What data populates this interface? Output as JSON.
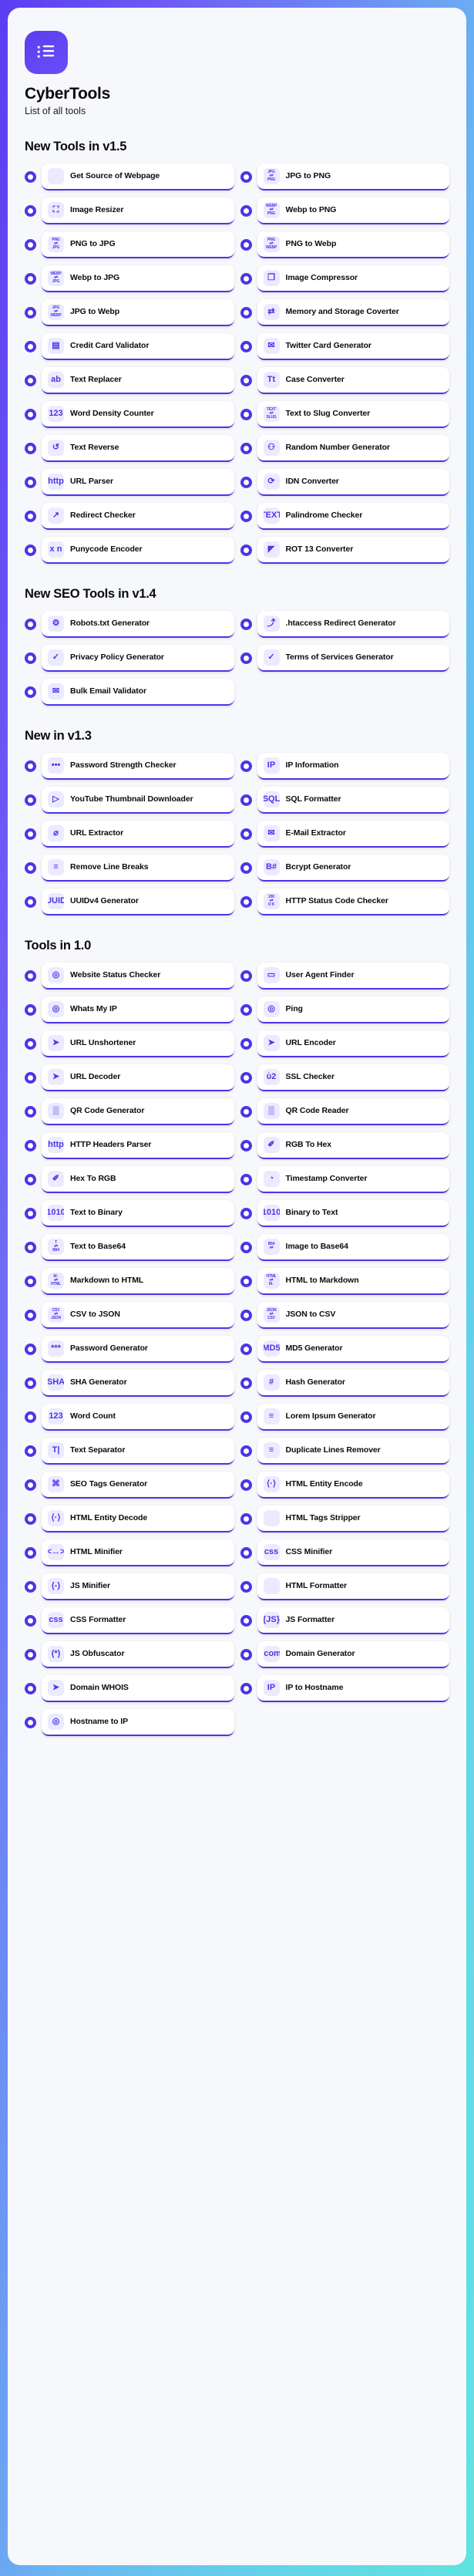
{
  "brand": {
    "logo_icon": "list-star-icon",
    "title": "CyberTools",
    "subtitle": "List of all tools"
  },
  "theme": {
    "accent": "#4c35e6",
    "icon_bg": "#eceaff",
    "page_bg": "#f7f8fb",
    "gradient_start": "#5b3df0",
    "gradient_end": "#5fe3e0"
  },
  "sections": [
    {
      "title": "New Tools in v1.5",
      "tools": [
        {
          "label": "Get Source of Webpage",
          "icon": "browser-code-icon",
          "glyph": "</>"
        },
        {
          "label": "JPG to PNG",
          "icon": "jpg-to-png-icon",
          "from": "JPG",
          "to": "PNG"
        },
        {
          "label": "Image Resizer",
          "icon": "image-resize-icon",
          "glyph": "⛶"
        },
        {
          "label": "Webp to PNG",
          "icon": "webp-to-png-icon",
          "from": "WEBP",
          "to": "PNG"
        },
        {
          "label": "PNG to JPG",
          "icon": "png-to-jpg-icon",
          "from": "PNG",
          "to": "JPG"
        },
        {
          "label": "PNG to Webp",
          "icon": "png-to-webp-icon",
          "from": "PNG",
          "to": "WEBP"
        },
        {
          "label": "Webp to JPG",
          "icon": "webp-to-jpg-icon",
          "from": "WEBP",
          "to": "JPG"
        },
        {
          "label": "Image Compressor",
          "icon": "image-compress-icon",
          "glyph": "❐"
        },
        {
          "label": "JPG to Webp",
          "icon": "jpg-to-webp-icon",
          "from": "JPG",
          "to": "WEBP"
        },
        {
          "label": "Memory and Storage Coverter",
          "icon": "memory-storage-icon",
          "glyph": "⇄"
        },
        {
          "label": "Credit Card Validator",
          "icon": "credit-card-icon",
          "glyph": "▤"
        },
        {
          "label": "Twitter Card Generator",
          "icon": "twitter-card-icon",
          "glyph": "✉"
        },
        {
          "label": "Text Replacer",
          "icon": "text-replace-icon",
          "glyph": "ab"
        },
        {
          "label": "Case Converter",
          "icon": "case-convert-icon",
          "glyph": "Tt"
        },
        {
          "label": "Word Density Counter",
          "icon": "word-density-icon",
          "glyph": "123"
        },
        {
          "label": "Text to Slug Converter",
          "icon": "text-to-slug-icon",
          "from": "TEXT",
          "to": "SLUG"
        },
        {
          "label": "Text Reverse",
          "icon": "text-reverse-icon",
          "glyph": "↺"
        },
        {
          "label": "Random Number Generator",
          "icon": "random-number-icon",
          "glyph": "⚇"
        },
        {
          "label": "URL Parser",
          "icon": "url-parser-icon",
          "glyph": "http"
        },
        {
          "label": "IDN Converter",
          "icon": "idn-converter-icon",
          "glyph": "⟳"
        },
        {
          "label": "Redirect Checker",
          "icon": "redirect-arrow-icon",
          "glyph": "↗"
        },
        {
          "label": "Palindrome Checker",
          "icon": "palindrome-icon",
          "glyph": "TEXT"
        },
        {
          "label": "Punycode Encoder",
          "icon": "punycode-icon",
          "glyph": "x n"
        },
        {
          "label": "ROT 13 Converter",
          "icon": "rot13-icon",
          "glyph": "◤"
        }
      ]
    },
    {
      "title": "New SEO Tools in v1.4",
      "tools": [
        {
          "label": "Robots.txt Generator",
          "icon": "robot-icon",
          "glyph": "⚙"
        },
        {
          "label": ".htaccess Redirect Generator",
          "icon": "htaccess-redirect-icon",
          "glyph": "⤴"
        },
        {
          "label": "Privacy Policy Generator",
          "icon": "shield-check-icon",
          "glyph": "✓"
        },
        {
          "label": "Terms of Services Generator",
          "icon": "clipboard-check-icon",
          "glyph": "✓"
        },
        {
          "label": "Bulk Email Validator",
          "icon": "email-check-icon",
          "glyph": "✉"
        }
      ]
    },
    {
      "title": "New in v1.3",
      "tools": [
        {
          "label": "Password Strength Checker",
          "icon": "password-dots-icon",
          "glyph": "•••"
        },
        {
          "label": "IP Information",
          "icon": "ip-info-icon",
          "glyph": "IP"
        },
        {
          "label": "YouTube Thumbnail Downloader",
          "icon": "youtube-play-icon",
          "glyph": "▷"
        },
        {
          "label": "SQL Formatter",
          "icon": "sql-icon",
          "glyph": "SQL"
        },
        {
          "label": "URL Extractor",
          "icon": "url-extract-icon",
          "glyph": "⌀"
        },
        {
          "label": "E-Mail Extractor",
          "icon": "email-extract-icon",
          "glyph": "✉"
        },
        {
          "label": "Remove Line Breaks",
          "icon": "line-break-remove-icon",
          "glyph": "≡"
        },
        {
          "label": "Bcrypt Generator",
          "icon": "bcrypt-icon",
          "glyph": "B#"
        },
        {
          "label": "UUIDv4 Generator",
          "icon": "uuid-icon",
          "glyph": "UUID"
        },
        {
          "label": "HTTP Status Code Checker",
          "icon": "http-status-icon",
          "from": "200",
          "to": "O K"
        }
      ]
    },
    {
      "title": "Tools in 1.0",
      "tools": [
        {
          "label": "Website Status Checker",
          "icon": "signal-icon",
          "glyph": "◎"
        },
        {
          "label": "User Agent Finder",
          "icon": "window-icon",
          "glyph": "▭"
        },
        {
          "label": "Whats My IP",
          "icon": "location-pin-icon",
          "glyph": "◎"
        },
        {
          "label": "Ping",
          "icon": "ping-search-icon",
          "glyph": "◎"
        },
        {
          "label": "URL Unshortener",
          "icon": "url-cursor-icon",
          "glyph": "➤"
        },
        {
          "label": "URL Encoder",
          "icon": "url-cursor-icon",
          "glyph": "➤"
        },
        {
          "label": "URL Decoder",
          "icon": "url-cursor-icon",
          "glyph": "➤"
        },
        {
          "label": "SSL Checker",
          "icon": "lock-icon",
          "glyph": "ὑ2"
        },
        {
          "label": "QR Code Generator",
          "icon": "qr-code-icon",
          "glyph": "▒"
        },
        {
          "label": "QR Code Reader",
          "icon": "qr-code-icon",
          "glyph": "▒"
        },
        {
          "label": "HTTP Headers Parser",
          "icon": "http-headers-icon",
          "glyph": "http"
        },
        {
          "label": "RGB To Hex",
          "icon": "eyedropper-icon",
          "glyph": "✐"
        },
        {
          "label": "Hex To RGB",
          "icon": "eyedropper-icon",
          "glyph": "✐"
        },
        {
          "label": "Timestamp Converter",
          "icon": "clock-icon",
          "glyph": "◔"
        },
        {
          "label": "Text to Binary",
          "icon": "binary-icon",
          "glyph": "1010"
        },
        {
          "label": "Binary to Text",
          "icon": "binary-icon",
          "glyph": "1010"
        },
        {
          "label": "Text to Base64",
          "icon": "text-base64-icon",
          "from": "T",
          "to": "B64"
        },
        {
          "label": "Image to Base64",
          "icon": "image-base64-icon",
          "from": "B64",
          "to": ""
        },
        {
          "label": "Markdown to HTML",
          "icon": "md-to-html-icon",
          "from": "M↓",
          "to": "HTML"
        },
        {
          "label": "HTML to Markdown",
          "icon": "html-to-md-icon",
          "from": "HTML",
          "to": "M↓"
        },
        {
          "label": "CSV to JSON",
          "icon": "csv-to-json-icon",
          "from": "CSV",
          "to": "JSON"
        },
        {
          "label": "JSON to CSV",
          "icon": "json-to-csv-icon",
          "from": "JSON",
          "to": "CSV"
        },
        {
          "label": "Password Generator",
          "icon": "password-asterisk-icon",
          "glyph": "***"
        },
        {
          "label": "MD5 Generator",
          "icon": "md5-icon",
          "glyph": "MD5"
        },
        {
          "label": "SHA Generator",
          "icon": "sha-icon",
          "glyph": "SHA"
        },
        {
          "label": "Hash Generator",
          "icon": "hash-icon",
          "glyph": "#"
        },
        {
          "label": "Word Count",
          "icon": "word-count-icon",
          "glyph": "123"
        },
        {
          "label": "Lorem Ipsum Generator",
          "icon": "paragraph-lines-icon",
          "glyph": "≡"
        },
        {
          "label": "Text Separator",
          "icon": "text-separator-icon",
          "glyph": "T|"
        },
        {
          "label": "Duplicate Lines Remover",
          "icon": "duplicate-remove-icon",
          "glyph": "≡"
        },
        {
          "label": "SEO Tags Generator",
          "icon": "tag-icon",
          "glyph": "⌘"
        },
        {
          "label": "HTML Entity Encode",
          "icon": "entity-encode-icon",
          "glyph": "⟨·⟩"
        },
        {
          "label": "HTML Entity Decode",
          "icon": "entity-decode-icon",
          "glyph": "⟨·⟩"
        },
        {
          "label": "HTML Tags Stripper",
          "icon": "code-tags-icon",
          "glyph": "</>"
        },
        {
          "label": "HTML Minifier",
          "icon": "html-minify-icon",
          "glyph": "<↔>"
        },
        {
          "label": "CSS Minifier",
          "icon": "css-icon",
          "glyph": "css"
        },
        {
          "label": "JS Minifier",
          "icon": "js-minify-icon",
          "glyph": "(-)"
        },
        {
          "label": "HTML Formatter",
          "icon": "code-tags-icon",
          "glyph": "</>"
        },
        {
          "label": "CSS Formatter",
          "icon": "css-icon",
          "glyph": "css"
        },
        {
          "label": "JS Formatter",
          "icon": "js-icon",
          "glyph": "{JS}"
        },
        {
          "label": "JS Obfuscator",
          "icon": "js-obfuscate-icon",
          "glyph": "(*)"
        },
        {
          "label": "Domain Generator",
          "icon": "domain-icon",
          "glyph": ".com"
        },
        {
          "label": "Domain WHOIS",
          "icon": "whois-cursor-icon",
          "glyph": "➤"
        },
        {
          "label": "IP to Hostname",
          "icon": "ip-host-icon",
          "glyph": "IP"
        },
        {
          "label": "Hostname to IP",
          "icon": "location-pin-icon",
          "glyph": "◎"
        }
      ]
    }
  ]
}
